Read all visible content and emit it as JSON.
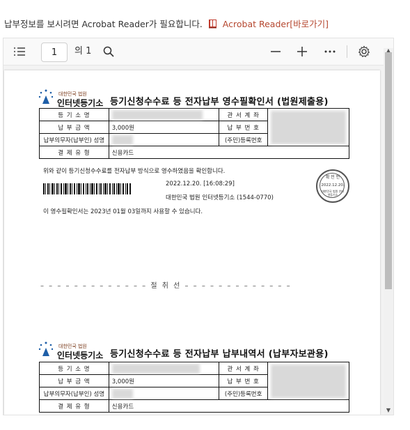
{
  "notice": {
    "text": "납부정보를 보시려면 Acrobat Reader가 필요합니다.",
    "link": "Acrobat Reader[바로가기]"
  },
  "toolbar": {
    "page_number": "1",
    "page_total": "의 1",
    "icons": [
      "contents-icon",
      "search-icon",
      "zoom-out-icon",
      "zoom-in-icon",
      "more-icon",
      "settings-icon"
    ]
  },
  "receipt": {
    "org_small": "대한민국 법원",
    "org_name": "인터넷등기소",
    "title": "등기신청수수료 등 전자납부 영수필확인서 (법원제출용)",
    "rows": {
      "reg_name_label": "등 기 소 명",
      "court_account_label": "관 서 계 좌",
      "amount_label": "납 부 금 액",
      "amount_value": "3,000원",
      "payment_no_label": "납 부 번 호",
      "payer_label": "납부의무자(납부인) 성명",
      "resident_label": "(주민)등록번호",
      "method_label": "결 제 유 형",
      "method_value": "신용카드"
    },
    "confirm_text": "위와 같이 등기신청수수료를 전자납부 방식으로 영수하였음을 확인합니다.",
    "datetime": "2022.12.20. [16:08:29]",
    "issuer": "대한민국 법원 인터넷등기소 (1544-0770)",
    "validity": "이 영수필확인서는 2023년 01월 03일까지 사용할 수 있습니다.",
    "stamp_top": "확 인 인",
    "stamp_date": "2022.12.20.",
    "stamp_bottom": "대한민국 법원 인터넷등기소"
  },
  "cut_line": "– – – – – – – – – – – – – 절 취 선 – – – – – – – – – – – – –",
  "receipt2": {
    "org_small": "대한민국 법원",
    "org_name": "인터넷등기소",
    "title": "등기신청수수료 등 전자납부 납부내역서 (납부자보관용)",
    "rows": {
      "reg_name_label": "등 기 소 명",
      "court_account_label": "관 서 계 좌",
      "amount_label": "납 부 금 액",
      "amount_value": "3,000원",
      "payment_no_label": "납 부 번 호",
      "payer_label": "납부의무자(납부인) 성명",
      "resident_label": "(주민)등록번호",
      "method_label": "결 제 유 형",
      "method_value": "신용카드"
    }
  }
}
